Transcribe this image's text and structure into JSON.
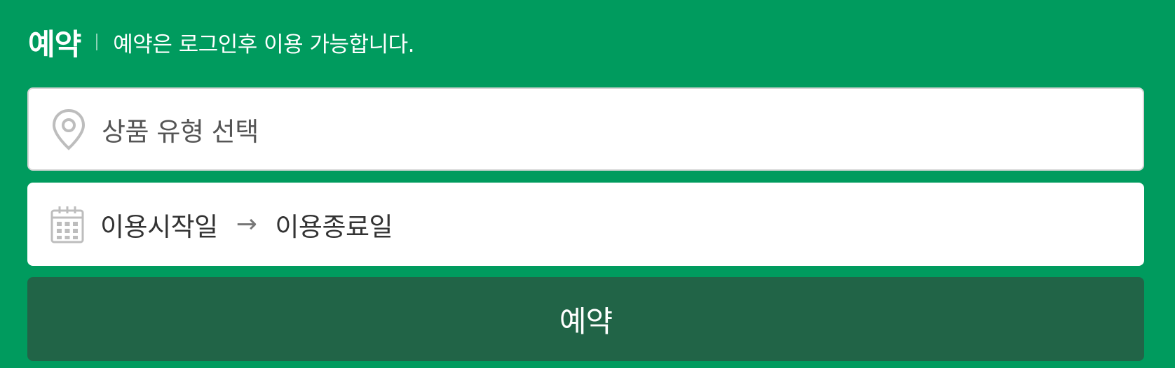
{
  "header": {
    "title": "예약",
    "notice": "예약은 로그인후 이용 가능합니다."
  },
  "product_field": {
    "icon": "location-pin-icon",
    "placeholder": "상품 유형 선택"
  },
  "date_field": {
    "icon": "calendar-icon",
    "start_label": "이용시작일",
    "arrow": "→",
    "end_label": "이용종료일"
  },
  "submit": {
    "label": "예약"
  },
  "colors": {
    "background": "#009B5E",
    "button": "#216447",
    "field_bg": "#FFFFFF",
    "icon_gray": "#BDBDBD"
  }
}
